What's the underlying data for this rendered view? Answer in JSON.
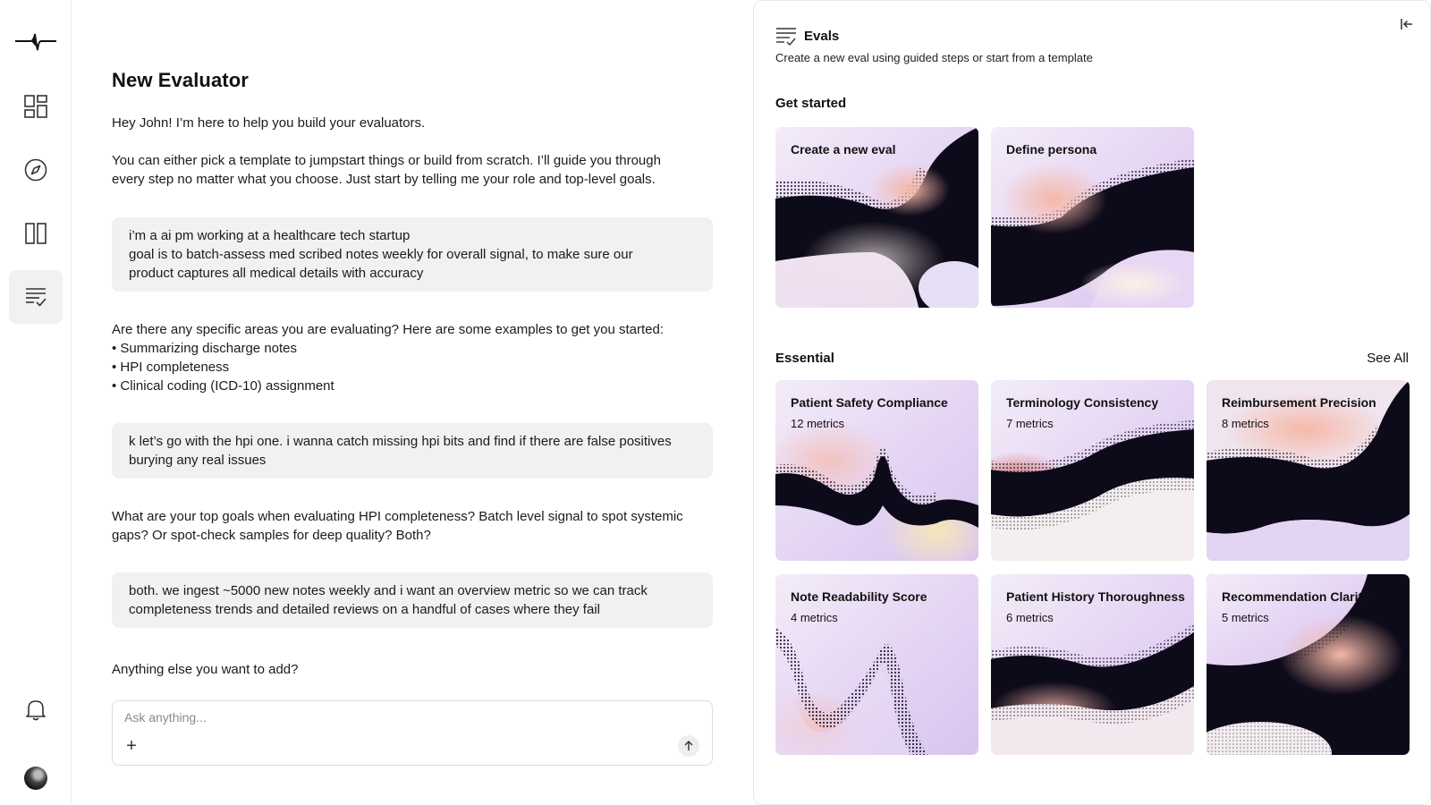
{
  "sidebar": {
    "items": [
      {
        "icon": "dashboard-icon"
      },
      {
        "icon": "compass-icon"
      },
      {
        "icon": "columns-icon"
      },
      {
        "icon": "evals-checklist-icon",
        "active": true
      }
    ],
    "bottom": [
      {
        "icon": "bell-icon"
      },
      {
        "icon": "avatar"
      }
    ]
  },
  "chat": {
    "title": "New Evaluator",
    "messages": [
      {
        "role": "assistant",
        "lines": [
          "Hey John! I’m here to help you build your evaluators."
        ]
      },
      {
        "role": "assistant",
        "lines": [
          "You can either pick a template to jumpstart things or build from scratch. I’ll guide you through",
          "every step no matter what you choose. Just start by telling me your role and top-level goals."
        ]
      },
      {
        "role": "user",
        "lines": [
          "i’m a ai pm working at a healthcare tech startup",
          "goal is to batch-assess med scribed notes weekly for overall signal, to make sure our",
          "product captures all medical details with accuracy"
        ]
      },
      {
        "role": "assistant",
        "lines": [
          "Are there any specific areas you are evaluating? Here are some examples to get you started:",
          "• Summarizing discharge notes",
          "• HPI completeness",
          "• Clinical coding (ICD-10) assignment"
        ]
      },
      {
        "role": "user",
        "lines": [
          "k let’s go with the hpi one. i wanna catch missing hpi bits and find if there are false positives",
          "burying any real issues"
        ]
      },
      {
        "role": "assistant",
        "lines": [
          "What are your top goals when evaluating HPI completeness? Batch level signal to spot systemic",
          "gaps? Or spot-check samples for deep quality? Both?"
        ]
      },
      {
        "role": "user",
        "lines": [
          "both. we ingest ~5000 new notes weekly and i want an overview metric so we can track",
          "completeness trends and detailed reviews on a handful of cases where they fail"
        ]
      },
      {
        "role": "assistant",
        "lines": [
          "Anything else you want to add?"
        ]
      }
    ],
    "input": {
      "placeholder": "Ask anything...",
      "value": "",
      "add_icon": "plus-icon",
      "send_icon": "arrow-up-icon"
    }
  },
  "panel": {
    "title": "Evals",
    "subtitle": "Create a new eval using guided steps or start from a template",
    "get_started": {
      "heading": "Get started",
      "cards": [
        {
          "title": "Create a new eval"
        },
        {
          "title": "Define persona"
        }
      ]
    },
    "essential": {
      "heading": "Essential",
      "see_all": "See All",
      "cards": [
        {
          "title": "Patient Safety Compliance",
          "meta": "12 metrics"
        },
        {
          "title": "Terminology Consistency",
          "meta": "7 metrics"
        },
        {
          "title": "Reimbursement Precision",
          "meta": "8 metrics"
        },
        {
          "title": "Note Readability Score",
          "meta": "4 metrics"
        },
        {
          "title": "Patient History Thoroughness",
          "meta": "6 metrics"
        },
        {
          "title": "Recommendation Clarity",
          "meta": "5 metrics"
        }
      ]
    }
  },
  "colors": {
    "active_nav_bg": "#f1f1f1",
    "bubble_bg": "#f1f1f1",
    "card_dark": "#0d0a1a",
    "card_lavender": "#e4d4f4",
    "card_peach": "#f4c2b4"
  }
}
